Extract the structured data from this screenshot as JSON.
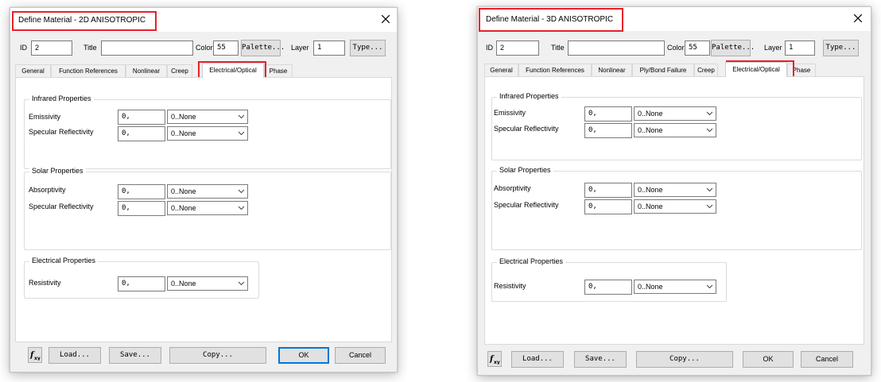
{
  "dialogs": [
    {
      "title": "Define Material - 2D ANISOTROPIC",
      "header": {
        "id_label": "ID",
        "id_value": "2",
        "title_label": "Title",
        "title_value": "",
        "color_label": "Color",
        "color_value": "55",
        "palette_label": "Palette...",
        "layer_label": "Layer",
        "layer_value": "1",
        "type_label": "Type..."
      },
      "tabs": [
        "General",
        "Function References",
        "Nonlinear",
        "Creep",
        "Electrical/Optical",
        "Phase"
      ],
      "active_tab": "Electrical/Optical",
      "groups": [
        {
          "title": "Infrared Properties",
          "rows": [
            {
              "label": "Emissivity",
              "value": "0,",
              "func": "0..None"
            },
            {
              "label": "Specular Reflectivity",
              "value": "0,",
              "func": "0..None"
            }
          ]
        },
        {
          "title": "Solar Properties",
          "rows": [
            {
              "label": "Absorptivity",
              "value": "0,",
              "func": "0..None"
            },
            {
              "label": "Specular Reflectivity",
              "value": "0,",
              "func": "0..None"
            }
          ]
        },
        {
          "title": "Electrical Properties",
          "rows": [
            {
              "label": "Resistivity",
              "value": "0,",
              "func": "0..None"
            }
          ]
        }
      ],
      "footer": {
        "load": "Load...",
        "save": "Save...",
        "copy": "Copy...",
        "ok": "OK",
        "cancel": "Cancel"
      }
    },
    {
      "title": "Define Material - 3D ANISOTROPIC",
      "header": {
        "id_label": "ID",
        "id_value": "2",
        "title_label": "Title",
        "title_value": "",
        "color_label": "Color",
        "color_value": "55",
        "palette_label": "Palette...",
        "layer_label": "Layer",
        "layer_value": "1",
        "type_label": "Type..."
      },
      "tabs": [
        "General",
        "Function References",
        "Nonlinear",
        "Ply/Bond Failure",
        "Creep",
        "Electrical/Optical",
        "Phase"
      ],
      "active_tab": "Electrical/Optical",
      "groups": [
        {
          "title": "Infrared Properties",
          "rows": [
            {
              "label": "Emissivity",
              "value": "0,",
              "func": "0..None"
            },
            {
              "label": "Specular Reflectivity",
              "value": "0,",
              "func": "0..None"
            }
          ]
        },
        {
          "title": "Solar Properties",
          "rows": [
            {
              "label": "Absorptivity",
              "value": "0,",
              "func": "0..None"
            },
            {
              "label": "Specular Reflectivity",
              "value": "0,",
              "func": "0..None"
            }
          ]
        },
        {
          "title": "Electrical Properties",
          "rows": [
            {
              "label": "Resistivity",
              "value": "0,",
              "func": "0..None"
            }
          ]
        }
      ],
      "footer": {
        "load": "Load...",
        "save": "Save...",
        "copy": "Copy...",
        "ok": "OK",
        "cancel": "Cancel"
      }
    }
  ],
  "colors": {
    "highlight": "#e8202a",
    "default_button": "#0078d7",
    "dialog_bg": "#f0f0f0"
  },
  "icons": {
    "close": "close-icon",
    "function": "fxy-function-icon",
    "dropdown": "chevron-down-icon"
  }
}
